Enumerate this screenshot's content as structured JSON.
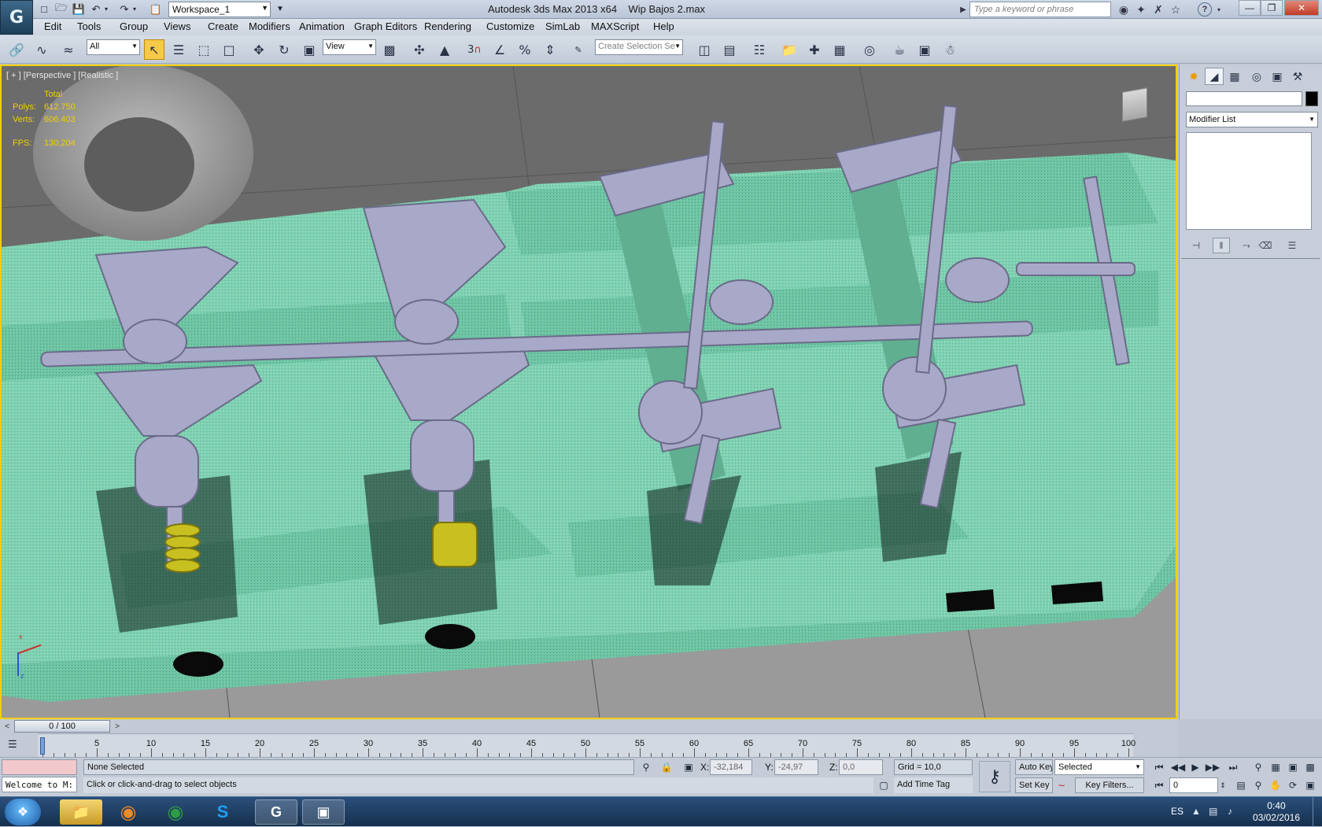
{
  "title_bar": {
    "app_title": "Autodesk 3ds Max  2013 x64",
    "file_name": "Wip Bajos 2.max",
    "workspace": "Workspace_1",
    "search_placeholder": "Type a keyword or phrase",
    "help_label": "?"
  },
  "menu": [
    "Edit",
    "Tools",
    "Group",
    "Views",
    "Create",
    "Modifiers",
    "Animation",
    "Graph Editors",
    "Rendering",
    "Customize",
    "SimLab",
    "MAXScript",
    "Help"
  ],
  "toolbar": {
    "filter": "All",
    "ref_coord": "View",
    "selection_set_placeholder": "Create Selection Se",
    "snap_angle_label": "3"
  },
  "viewport": {
    "label": "[ + ] [Perspective ] [Realistic ]",
    "stats_header": "Total",
    "polys_label": "Polys:",
    "polys_value": "612.750",
    "verts_label": "Verts:",
    "verts_value": "606.403",
    "fps_label": "FPS:",
    "fps_value": "130,204",
    "axis_z": "z",
    "axis_x": "x"
  },
  "command_panel": {
    "modifier_list": "Modifier List"
  },
  "timeline": {
    "frame_display": "0 / 100",
    "ticks": [
      "0",
      "5",
      "10",
      "15",
      "20",
      "25",
      "30",
      "35",
      "40",
      "45",
      "50",
      "55",
      "60",
      "65",
      "70",
      "75",
      "80",
      "85",
      "90",
      "95",
      "100"
    ]
  },
  "status": {
    "selection": "None Selected",
    "prompt": "Click or click-and-drag to select objects",
    "listener": "Welcome to M:",
    "x_label": "X:",
    "x_value": "-32,184",
    "y_label": "Y:",
    "y_value": "-24,97",
    "z_label": "Z:",
    "z_value": "0,0",
    "grid": "Grid = 10,0",
    "add_time_tag": "Add Time Tag",
    "auto_key": "Auto Key",
    "set_key": "Set Key",
    "key_mode": "Selected",
    "key_filters": "Key Filters...",
    "current_frame": "0"
  },
  "taskbar": {
    "language": "ES",
    "time": "0:40",
    "date": "03/02/2016"
  },
  "colors": {
    "viewport_border": "#f0d000",
    "stat_text": "#f0d000",
    "chassis": "#7fd1b2",
    "mechanics": "#a8a9c8",
    "spring": "#c8c020"
  }
}
